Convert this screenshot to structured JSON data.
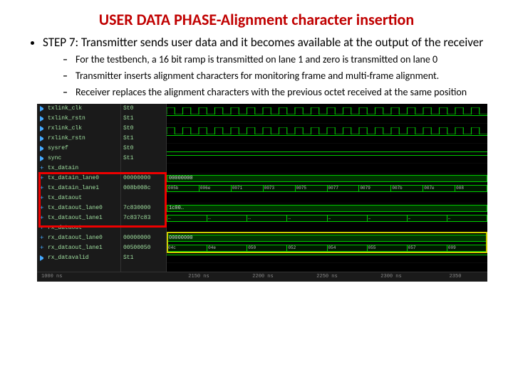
{
  "title": "USER DATA PHASE-Alignment character insertion",
  "main_bullet": "STEP 7: Transmitter sends user data and it becomes available at the output of the receiver",
  "sub1": "For the testbench, a 16 bit ramp is transmitted on lane 1 and zero is transmitted on lane 0",
  "sub2": "Transmitter inserts alignment characters for monitoring frame and multi-frame alignment.",
  "sub3": "Receiver replaces the alignment characters with the previous octet received at the same position",
  "signals": {
    "s0": "txlink_clk",
    "v0": "St0",
    "s1": "txlink_rstn",
    "v1": "St1",
    "s2": "rxlink_clk",
    "v2": "St0",
    "s3": "rxlink_rstn",
    "v3": "St1",
    "s4": "sysref",
    "v4": "St0",
    "s5": "sync",
    "v5": "St1",
    "s6": "tx_datain",
    "v6": "",
    "s7": "tx_datain_lane0",
    "v7": "00000000",
    "s8": "tx_datain_lane1",
    "v8": "008b008c",
    "s9": "tx_dataout",
    "v9": "",
    "s10": "tx_dataout_lane0",
    "v10": "7c830000",
    "s11": "tx_dataout_lane1",
    "v11": "7c837c83",
    "s12": "rx_dataout",
    "v12": "",
    "s13": "rx_dataout_lane0",
    "v13": "00000000",
    "s14": "rx_dataout_lane1",
    "v14": "00500050",
    "s15": "rx_datavalid",
    "v15": "St1"
  },
  "lane1_segments": [
    "04c ",
    "04e ",
    "050 ",
    "052 ",
    "054 ",
    "055 ",
    "057 ",
    "009"
  ],
  "time": {
    "t0": "1000 ns",
    "t1": "2150 ns",
    "t2": "2200 ns",
    "t3": "2250 ns",
    "t4": "2300 ns",
    "t5": "2350"
  }
}
